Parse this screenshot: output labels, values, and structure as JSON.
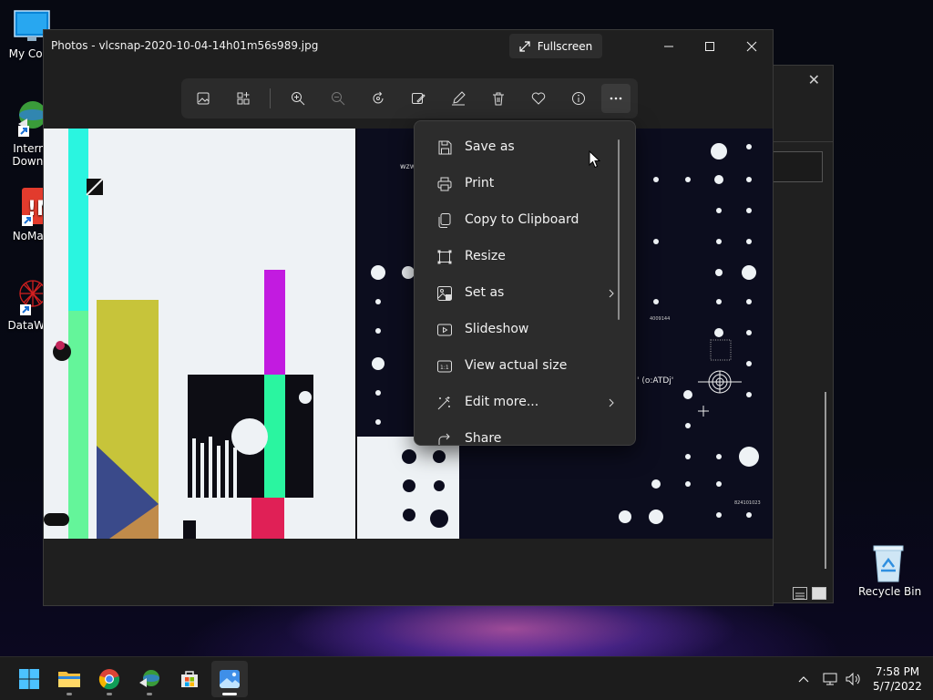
{
  "desktop": {
    "icons": [
      {
        "label": "My Com"
      },
      {
        "label": "Intern"
      },
      {
        "label": "Downl"
      },
      {
        "label": "NoMac"
      },
      {
        "label": "DataWa"
      }
    ],
    "recycle_bin": {
      "label": "Recycle Bin"
    }
  },
  "photos_window": {
    "title": "Photos - vlcsnap-2020-10-04-14h01m56s989.jpg",
    "fullscreen_label": "Fullscreen",
    "toolbar": [
      {
        "name": "view-all-icon"
      },
      {
        "name": "add-to-album-icon"
      },
      {
        "name": "zoom-in-icon"
      },
      {
        "name": "zoom-out-icon"
      },
      {
        "name": "rotate-icon"
      },
      {
        "name": "edit-image-icon"
      },
      {
        "name": "draw-icon"
      },
      {
        "name": "delete-icon"
      },
      {
        "name": "favorite-icon"
      },
      {
        "name": "info-icon"
      },
      {
        "name": "see-more-icon"
      }
    ],
    "image_text": {
      "t1": "wzw",
      "t2": "' (o:ATDj'",
      "t3": "4009144",
      "t4": "824101023"
    }
  },
  "context_menu": {
    "items": [
      {
        "label": "Save as",
        "icon": "save-icon"
      },
      {
        "label": "Print",
        "icon": "print-icon"
      },
      {
        "label": "Copy to Clipboard",
        "icon": "copy-icon"
      },
      {
        "label": "Resize",
        "icon": "resize-icon"
      },
      {
        "label": "Set as",
        "icon": "set-as-icon",
        "submenu": true
      },
      {
        "label": "Slideshow",
        "icon": "slideshow-icon"
      },
      {
        "label": "View actual size",
        "icon": "actual-size-icon"
      },
      {
        "label": "Edit more...",
        "icon": "edit-more-icon",
        "submenu": true
      },
      {
        "label": "Share",
        "icon": "share-icon"
      }
    ]
  },
  "taskbar": {
    "apps": [
      {
        "name": "start-icon"
      },
      {
        "name": "file-explorer-icon"
      },
      {
        "name": "chrome-icon"
      },
      {
        "name": "download-manager-icon"
      },
      {
        "name": "microsoft-store-icon"
      },
      {
        "name": "photos-icon"
      }
    ],
    "clock": {
      "time": "7:58 PM",
      "date": "5/7/2022"
    }
  },
  "colors": {
    "menu_bg": "#2c2c2c",
    "window_bg": "#1f1f1f",
    "accent_cyan": "#2af5e0",
    "accent_magenta": "#c21be0"
  }
}
